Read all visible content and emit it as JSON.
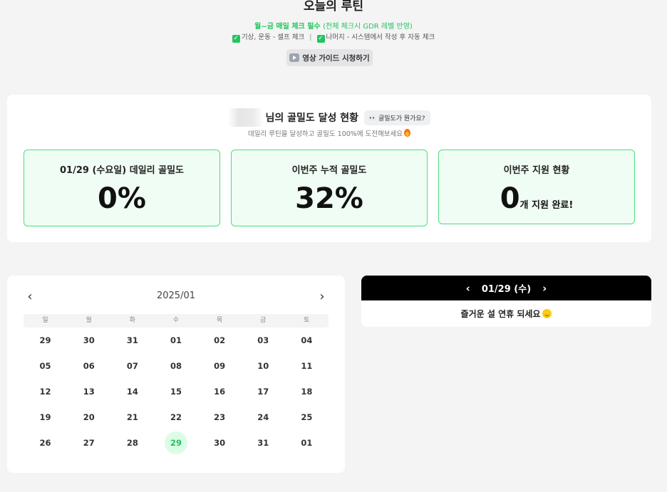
{
  "header": {
    "title": "오늘의 루틴",
    "rule_main": "월~금 매일 체크 필수",
    "rule_note": "(전체 체크시 GDR 레벨 반영)",
    "sub_part1": "기상, 운동 - 셀프 체크",
    "sub_separator": "|",
    "sub_part2": "나머지 - 시스템에서 작성 후 자동 체크",
    "guide_button": "영상 가이드 시청하기"
  },
  "status": {
    "title": "님의 골밀도 달성 현황",
    "what_button": "골밀도가 뭔가요?",
    "subtitle": "데일리 루틴을 달성하고 골밀도 100%에 도전해보세요",
    "boxes": [
      {
        "label": "01/29 (수요일) 데일리 골밀도",
        "value": "0%",
        "unit": ""
      },
      {
        "label": "이번주 누적 골밀도",
        "value": "32%",
        "unit": ""
      },
      {
        "label": "이번주 지원 현황",
        "value": "0",
        "unit": "개 지원 완료!"
      }
    ]
  },
  "calendar": {
    "month": "2025/01",
    "prev": "‹",
    "next": "›",
    "weekdays": [
      "일",
      "월",
      "화",
      "수",
      "목",
      "금",
      "토"
    ],
    "weeks": [
      [
        "29",
        "30",
        "31",
        "01",
        "02",
        "03",
        "04"
      ],
      [
        "05",
        "06",
        "07",
        "08",
        "09",
        "10",
        "11"
      ],
      [
        "12",
        "13",
        "14",
        "15",
        "16",
        "17",
        "18"
      ],
      [
        "19",
        "20",
        "21",
        "22",
        "23",
        "24",
        "25"
      ],
      [
        "26",
        "27",
        "28",
        "29",
        "30",
        "31",
        "01"
      ]
    ],
    "selected": "29"
  },
  "detail": {
    "date": "01/29 (수)",
    "prev": "‹",
    "next": "›",
    "message": "즐거운 설 연휴 되세요"
  },
  "colors": {
    "accent_green": "#22c55e",
    "box_bg": "#f0fdf4",
    "box_border": "#4ade80"
  }
}
